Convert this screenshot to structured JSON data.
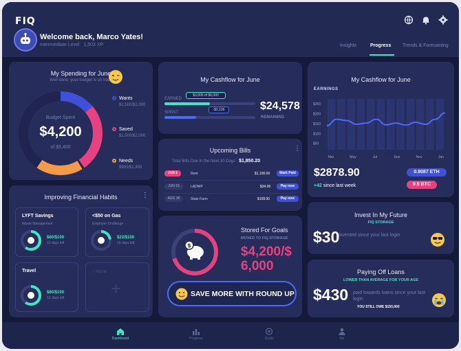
{
  "app": {
    "logo": "FIQ"
  },
  "user": {
    "welcome": "Welcome back, Marco Yates!",
    "level": "Intermediate Level",
    "xp": "1,503 XP"
  },
  "tabs": [
    {
      "label": "Insights"
    },
    {
      "label": "Progress"
    },
    {
      "label": "Trends & Forecasting"
    }
  ],
  "spending": {
    "title": "My Spending for June",
    "subtitle": "Well done, your budget is on track",
    "center_label": "Budget Spent",
    "center_value": "$4,200",
    "center_of": "of $5,400",
    "legend": [
      {
        "name": "Wants",
        "value": "$1,500/$2,000",
        "color": "#3f51d9"
      },
      {
        "name": "Saved",
        "value": "$1,500/$2,000",
        "color": "#e8417f"
      },
      {
        "name": "Needs",
        "value": "$900/$1,400",
        "color": "#f59a45"
      }
    ]
  },
  "cashflow": {
    "title": "My Cashflow for June",
    "earned_label": "EARNED",
    "earned_badge": "$3,000 of $6,000",
    "earned_fraction": 0.5,
    "spent_label": "SPENT",
    "spent_badge": "-$2,106",
    "spent_fraction": 0.35,
    "remaining_value": "$24,578",
    "remaining_label": "REMAINING"
  },
  "bills": {
    "title": "Upcoming Bills",
    "total_label": "Total Bills Due in the Next 30 Days",
    "total_value": "$1,850.20",
    "rows": [
      {
        "date": "JUN 1",
        "name": "Rent",
        "amount": "$1,100.00",
        "action": "Mark Paid",
        "urgent": true
      },
      {
        "date": "JUN 15",
        "name": "LADWP",
        "amount": "$34.00",
        "action": "Pay now",
        "urgent": false
      },
      {
        "date": "AUG 30",
        "name": "State Farm",
        "amount": "$108.00",
        "action": "Pay now",
        "urgent": false
      }
    ]
  },
  "stored": {
    "title": "Stored For Goals",
    "subtitle": "MOVED TO FIQ STORAGE",
    "amount_line1": "$4,200/$",
    "amount_line2": "6,000",
    "progress": 0.7,
    "button": "SAVE MORE WITH ROUND UP"
  },
  "habits": {
    "title": "Improving Financial Habits",
    "items": [
      {
        "title": "LYFT Savings",
        "subtitle": "Waste Management",
        "progress_text": "$60/$100",
        "days": "12 days left",
        "progress": 0.6
      },
      {
        "title": "<$50 on Gas",
        "subtitle": "Employer Challenge",
        "progress_text": "$23/$100",
        "days": "15 days left",
        "progress": 0.23
      },
      {
        "title": "Travel",
        "subtitle": "",
        "progress_text": "$60/$100",
        "days": "12 days left",
        "progress": 0.6
      }
    ],
    "add_label": "Home"
  },
  "earnings": {
    "title": "My Cashflow for June",
    "label": "EARNINGS",
    "amount": "$2878.90",
    "change": "+42",
    "change_label": "since last week",
    "eth": "0.9087 ETH",
    "btc": "0.5 BTC"
  },
  "chart_data": {
    "type": "line",
    "categories": [
      "Mar",
      "May",
      "Jul",
      "Sep",
      "Nov",
      "Jan"
    ],
    "x": [
      0,
      1,
      2,
      3,
      4,
      5,
      6,
      7,
      8,
      9,
      10,
      11,
      12
    ],
    "values": [
      145,
      170,
      165,
      150,
      155,
      170,
      148,
      155,
      147,
      158,
      150,
      170,
      195
    ],
    "yticks": [
      "$250",
      "$200",
      "$150",
      "$100",
      "$50"
    ],
    "ylim": [
      50,
      250
    ],
    "color": "#4a6cf7"
  },
  "invest": {
    "title": "Invest In My Future",
    "subtitle": "FIQ STORAGE",
    "amount": "$30",
    "caption": "invested since your last login"
  },
  "loans": {
    "title": "Paying Off Loans",
    "subtitle": "LOWER THAN AVERAGE FOR YOUR AGE",
    "amount": "$430",
    "caption": "paid towards loans since your last login",
    "owe": "YOU STILL OWE $150,000"
  },
  "nav": [
    {
      "label": "Dashboard"
    },
    {
      "label": "Progress"
    },
    {
      "label": "Goals"
    },
    {
      "label": "Me"
    }
  ]
}
